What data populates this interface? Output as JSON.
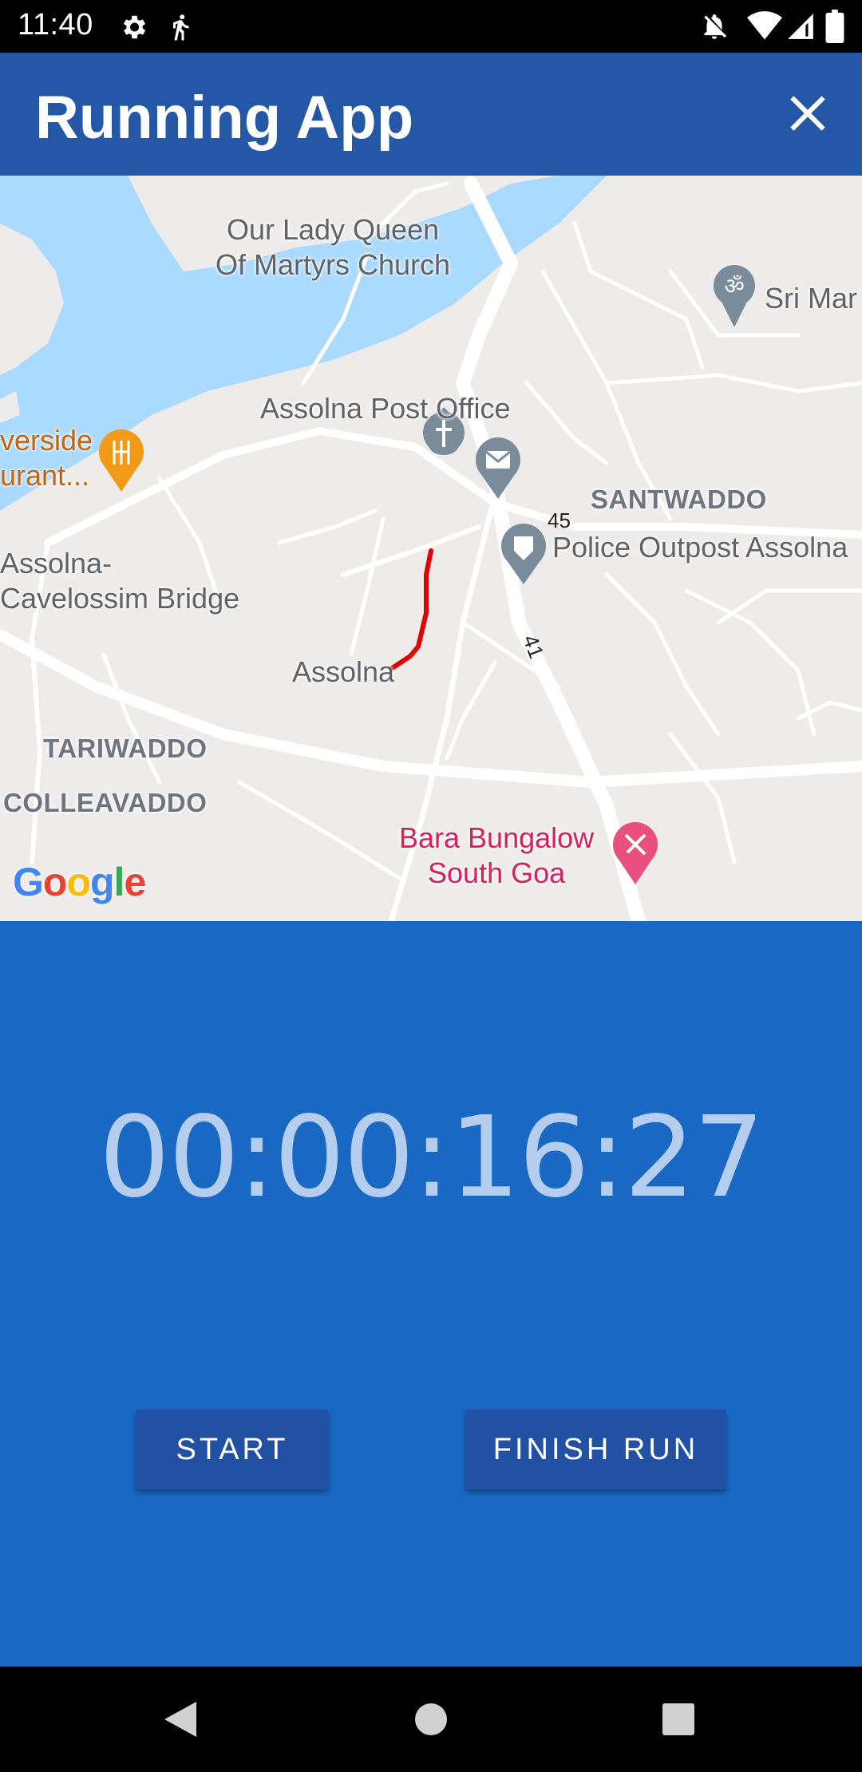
{
  "status_bar": {
    "time": "11:40",
    "left_icons": [
      "gear-icon",
      "running-icon"
    ],
    "right_icons": [
      "notifications-off-icon",
      "wifi-icon",
      "signal-icon",
      "battery-icon"
    ]
  },
  "app_bar": {
    "title": "Running App",
    "close_icon": "close-icon",
    "color": "#2557a7"
  },
  "map": {
    "labels": {
      "church": "Our Lady Queen\nOf Martyrs Church",
      "temple": "Sri Mar",
      "post_office": "Assolna Post Office",
      "restaurant": "verside\nurant...",
      "santwaddo": "SANTWADDO",
      "police": "Police Outpost Assolna",
      "bridge": "Assolna-\nCavelossim Bridge",
      "assolna": "Assolna",
      "tariwaddo": "TARIWADDO",
      "colleavaddo": "COLLEAVADDO",
      "bungalow": "Bara Bungalow\nSouth Goa",
      "road_45": "45",
      "road_41": "41"
    },
    "route_color": "#e00000",
    "water_color": "#aadaff",
    "logo": "Google"
  },
  "timer": {
    "value": "00:00:16:27",
    "color": "#b5cdee"
  },
  "buttons": {
    "start": "START",
    "finish": "FINISH RUN"
  },
  "nav_bar": {
    "icons": [
      "back-icon",
      "home-icon",
      "recents-icon"
    ]
  },
  "colors": {
    "panel": "#1868c4",
    "button": "#2251a4"
  }
}
